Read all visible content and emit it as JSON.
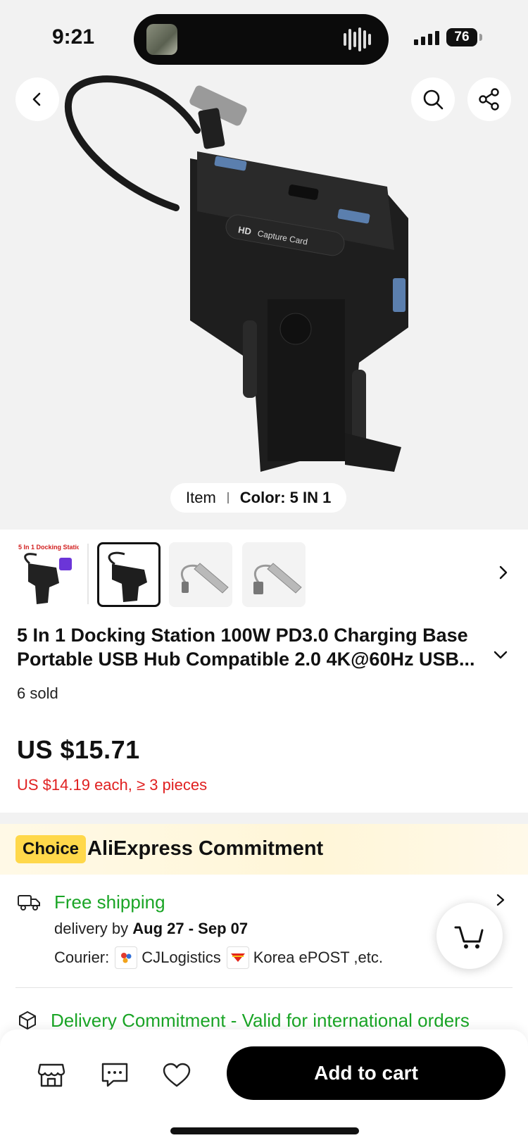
{
  "status_bar": {
    "time": "9:21",
    "battery": "76"
  },
  "hero": {
    "option_label": "Item",
    "option_value": "Color: 5 IN 1",
    "product_print": {
      "hd": "HD",
      "caption": "Capture Card"
    }
  },
  "thumbnails": [
    {
      "caption": "5 In 1 Docking Station",
      "selected": false
    },
    {
      "caption": "",
      "selected": true
    },
    {
      "caption": "",
      "selected": false
    },
    {
      "caption": "",
      "selected": false
    }
  ],
  "product": {
    "title_line1": "5 In 1 Docking Station 100W PD3.0 Charging Base",
    "title_line2": "Portable USB Hub Compatible 2.0 4K@60Hz USB...",
    "sold": "6 sold",
    "price": "US $15.71",
    "bulk_price": "US $14.19 each, ≥ 3 pieces"
  },
  "choice": {
    "badge": "Choice",
    "title": "AliExpress Commitment"
  },
  "shipping": {
    "free_label": "Free shipping",
    "delivery_prefix": "delivery by ",
    "delivery_dates": "Aug 27 - Sep 07",
    "courier_label": "Courier:",
    "couriers": [
      "CJLogistics",
      "Korea ePOST ,etc."
    ]
  },
  "delivery_commitment": "Delivery Commitment - Valid for international orders",
  "bottom": {
    "add_to_cart": "Add to cart"
  },
  "colors": {
    "accent": "#000000",
    "green": "#1aa526",
    "red": "#e02020",
    "choice_yellow": "#ffd84a"
  }
}
